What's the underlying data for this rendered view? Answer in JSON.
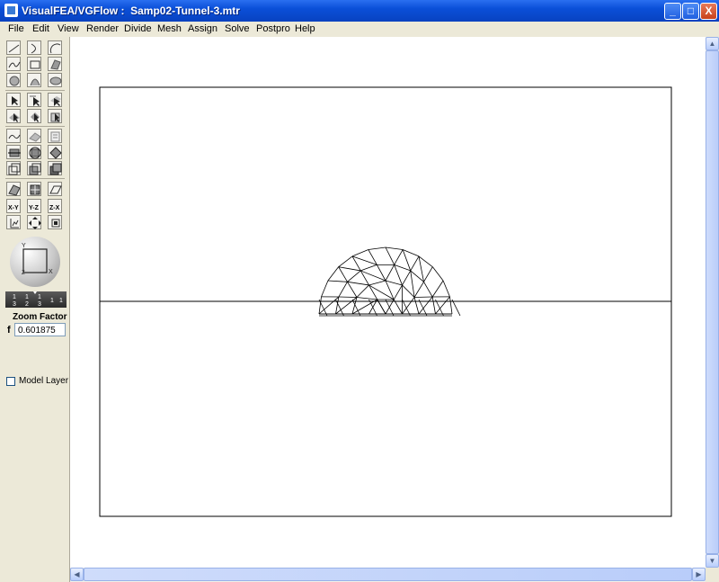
{
  "window": {
    "title": "VisualFEA/VGFlow :  Samp02-Tunnel-3.mtr",
    "controls": {
      "minimize": "_",
      "maximize": "□",
      "close": "X"
    }
  },
  "menu": [
    "File",
    "Edit",
    "View",
    "Render",
    "Divide",
    "Mesh",
    "Assign",
    "Solve",
    "Postpro",
    "Help"
  ],
  "toolbar": {
    "axis_buttons": [
      "X-Y",
      "Y-Z",
      "Z-X"
    ],
    "ruler_ticks": [
      "1",
      "1",
      "1",
      "1",
      "1"
    ],
    "ruler_denoms": [
      "3",
      "2",
      "3"
    ],
    "zoom_label": "Zoom Factor",
    "zoom_symbol": "f",
    "zoom_value": "0.601875",
    "model_layer_label": "Model Layer"
  },
  "colors": {
    "titlebar": "#0a4fd8",
    "canvas": "#ffffff",
    "mesh": "#000000"
  },
  "icons": [
    "line-tool-icon",
    "arc-tool-icon",
    "circle-arc-tool-icon",
    "spline-tool-icon",
    "rectangle-tool-icon",
    "surface-tool-icon",
    "circle-tool-icon",
    "ellipse-tool-icon",
    "sphere-tool-icon",
    "select-arrow-icon",
    "select-node-icon",
    "select-face-icon",
    "select-solid-icon",
    "rotate-solid-icon",
    "select-box-icon",
    "curve-edit-icon",
    "surface-edit-icon",
    "list-icon",
    "move-solid-icon",
    "rotate-view-icon",
    "spin-view-icon",
    "wire-cube-icon",
    "shaded-cube-icon",
    "fill-cube-icon",
    "render-a-icon",
    "render-b-icon",
    "plane-icon",
    "pan-icon",
    "fit-view-icon",
    "center-icon"
  ]
}
